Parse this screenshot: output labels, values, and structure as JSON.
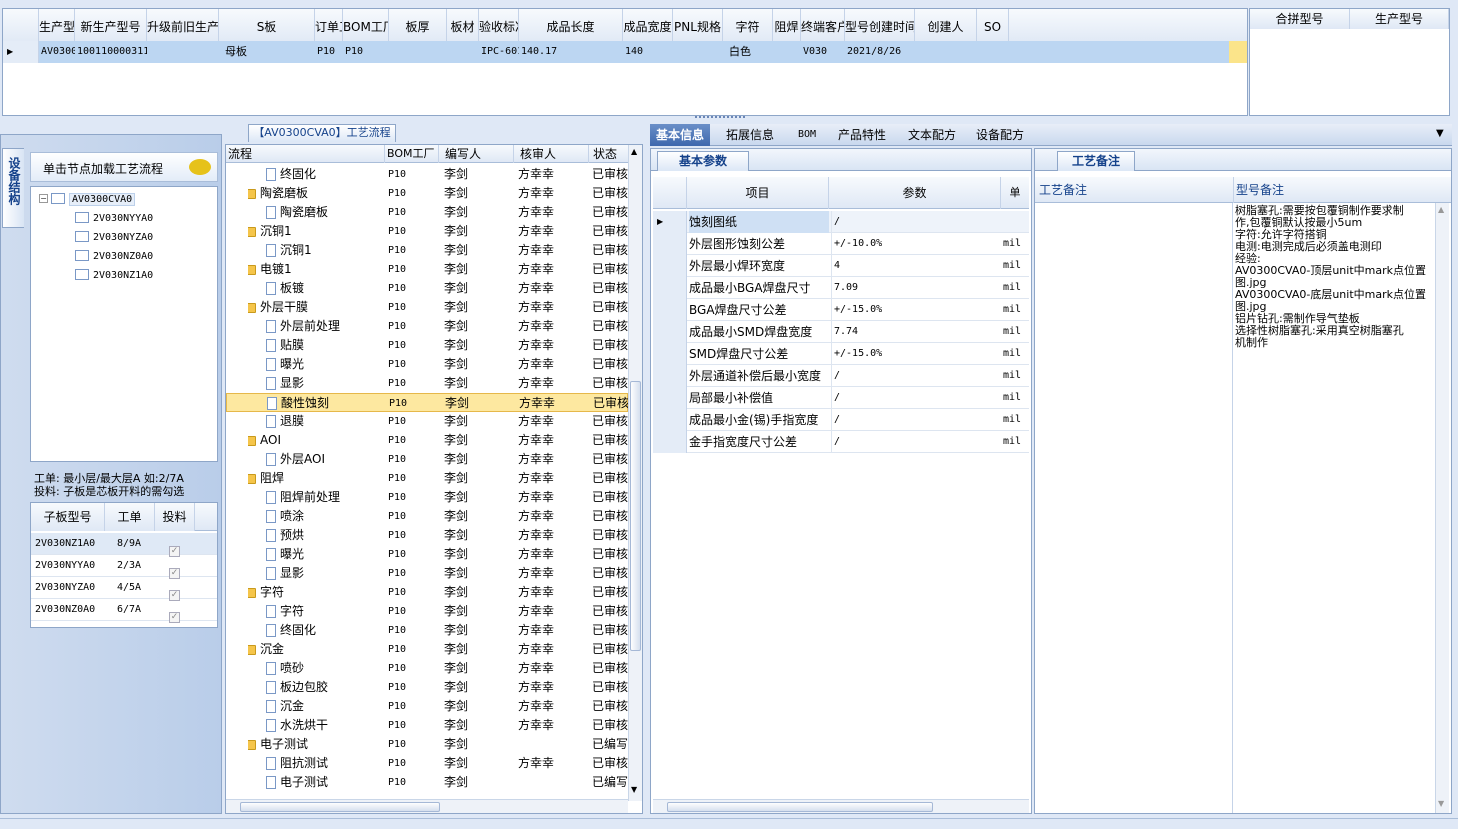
{
  "top_grid": {
    "columns": [
      "生产型号",
      "新生产型号",
      "升级前旧生产型号",
      "S板",
      "订单工厂",
      "BOM工厂",
      "板厚",
      "板材",
      "验收标准",
      "成品长度",
      "成品宽度",
      "PNL规格",
      "字符",
      "阻焊",
      "终端客户代码",
      "型号创建时间",
      "创建人",
      "SO"
    ],
    "row": [
      "AV0300CVA0",
      "10011000031143",
      "",
      "母板",
      "P10",
      "P10",
      "",
      "",
      "IPC-6012 Ⅱ级",
      "140.17",
      "140",
      "",
      "白色",
      "",
      "V030",
      "2021/8/26",
      "",
      ""
    ]
  },
  "right_grid": {
    "columns": [
      "合拼型号",
      "生产型号"
    ]
  },
  "left_panel": {
    "side_tab": "设备结构",
    "hint": "单击节点加载工艺流程",
    "tree_root": "AV0300CVA0",
    "tree_children": [
      "2V030NYYA0",
      "2V030NYZA0",
      "2V030NZ0A0",
      "2V030NZ1A0"
    ],
    "note1": "工单: 最小层/最大层A 如:2/7A",
    "note2": "投料: 子板是芯板开料的需勾选",
    "sub_columns": [
      "子板型号",
      "工单",
      "投料"
    ],
    "sub_rows": [
      {
        "model": "2V030NZ1A0",
        "order": "8/9A"
      },
      {
        "model": "2V030NYYA0",
        "order": "2/3A"
      },
      {
        "model": "2V030NYZA0",
        "order": "4/5A"
      },
      {
        "model": "2V030NZ0A0",
        "order": "6/7A"
      }
    ]
  },
  "process": {
    "title": "【AV0300CVA0】工艺流程",
    "columns": [
      "流程",
      "BOM工厂",
      "编写人",
      "核审人",
      "状态"
    ],
    "rows": [
      {
        "name": "终固化",
        "lvl": 1,
        "bom": "P10",
        "writer": "李剑",
        "reviewer": "方幸幸",
        "status": "已审核"
      },
      {
        "name": "陶瓷磨板",
        "lvl": 0,
        "bom": "P10",
        "writer": "李剑",
        "reviewer": "方幸幸",
        "status": "已审核"
      },
      {
        "name": "陶瓷磨板",
        "lvl": 1,
        "bom": "P10",
        "writer": "李剑",
        "reviewer": "方幸幸",
        "status": "已审核"
      },
      {
        "name": "沉铜1",
        "lvl": 0,
        "bom": "P10",
        "writer": "李剑",
        "reviewer": "方幸幸",
        "status": "已审核"
      },
      {
        "name": "沉铜1",
        "lvl": 1,
        "bom": "P10",
        "writer": "李剑",
        "reviewer": "方幸幸",
        "status": "已审核"
      },
      {
        "name": "电镀1",
        "lvl": 0,
        "bom": "P10",
        "writer": "李剑",
        "reviewer": "方幸幸",
        "status": "已审核"
      },
      {
        "name": "板镀",
        "lvl": 1,
        "bom": "P10",
        "writer": "李剑",
        "reviewer": "方幸幸",
        "status": "已审核"
      },
      {
        "name": "外层干膜",
        "lvl": 0,
        "bom": "P10",
        "writer": "李剑",
        "reviewer": "方幸幸",
        "status": "已审核"
      },
      {
        "name": "外层前处理",
        "lvl": 1,
        "bom": "P10",
        "writer": "李剑",
        "reviewer": "方幸幸",
        "status": "已审核"
      },
      {
        "name": "贴膜",
        "lvl": 1,
        "bom": "P10",
        "writer": "李剑",
        "reviewer": "方幸幸",
        "status": "已审核"
      },
      {
        "name": "曝光",
        "lvl": 1,
        "bom": "P10",
        "writer": "李剑",
        "reviewer": "方幸幸",
        "status": "已审核"
      },
      {
        "name": "显影",
        "lvl": 1,
        "bom": "P10",
        "writer": "李剑",
        "reviewer": "方幸幸",
        "status": "已审核"
      },
      {
        "name": "酸性蚀刻",
        "lvl": 1,
        "bom": "P10",
        "writer": "李剑",
        "reviewer": "方幸幸",
        "status": "已审核",
        "selected": true
      },
      {
        "name": "退膜",
        "lvl": 1,
        "bom": "P10",
        "writer": "李剑",
        "reviewer": "方幸幸",
        "status": "已审核"
      },
      {
        "name": "AOI",
        "lvl": 0,
        "bom": "P10",
        "writer": "李剑",
        "reviewer": "方幸幸",
        "status": "已审核"
      },
      {
        "name": "外层AOI",
        "lvl": 1,
        "bom": "P10",
        "writer": "李剑",
        "reviewer": "方幸幸",
        "status": "已审核"
      },
      {
        "name": "阻焊",
        "lvl": 0,
        "bom": "P10",
        "writer": "李剑",
        "reviewer": "方幸幸",
        "status": "已审核"
      },
      {
        "name": "阻焊前处理",
        "lvl": 1,
        "bom": "P10",
        "writer": "李剑",
        "reviewer": "方幸幸",
        "status": "已审核"
      },
      {
        "name": "喷涂",
        "lvl": 1,
        "bom": "P10",
        "writer": "李剑",
        "reviewer": "方幸幸",
        "status": "已审核"
      },
      {
        "name": "预烘",
        "lvl": 1,
        "bom": "P10",
        "writer": "李剑",
        "reviewer": "方幸幸",
        "status": "已审核"
      },
      {
        "name": "曝光",
        "lvl": 1,
        "bom": "P10",
        "writer": "李剑",
        "reviewer": "方幸幸",
        "status": "已审核"
      },
      {
        "name": "显影",
        "lvl": 1,
        "bom": "P10",
        "writer": "李剑",
        "reviewer": "方幸幸",
        "status": "已审核"
      },
      {
        "name": "字符",
        "lvl": 0,
        "bom": "P10",
        "writer": "李剑",
        "reviewer": "方幸幸",
        "status": "已审核"
      },
      {
        "name": "字符",
        "lvl": 1,
        "bom": "P10",
        "writer": "李剑",
        "reviewer": "方幸幸",
        "status": "已审核"
      },
      {
        "name": "终固化",
        "lvl": 1,
        "bom": "P10",
        "writer": "李剑",
        "reviewer": "方幸幸",
        "status": "已审核"
      },
      {
        "name": "沉金",
        "lvl": 0,
        "bom": "P10",
        "writer": "李剑",
        "reviewer": "方幸幸",
        "status": "已审核"
      },
      {
        "name": "喷砂",
        "lvl": 1,
        "bom": "P10",
        "writer": "李剑",
        "reviewer": "方幸幸",
        "status": "已审核"
      },
      {
        "name": "板边包胶",
        "lvl": 1,
        "bom": "P10",
        "writer": "李剑",
        "reviewer": "方幸幸",
        "status": "已审核"
      },
      {
        "name": "沉金",
        "lvl": 1,
        "bom": "P10",
        "writer": "李剑",
        "reviewer": "方幸幸",
        "status": "已审核"
      },
      {
        "name": "水洗烘干",
        "lvl": 1,
        "bom": "P10",
        "writer": "李剑",
        "reviewer": "方幸幸",
        "status": "已审核"
      },
      {
        "name": "电子测试",
        "lvl": 0,
        "bom": "P10",
        "writer": "李剑",
        "reviewer": "",
        "status": "已编写"
      },
      {
        "name": "阻抗测试",
        "lvl": 1,
        "bom": "P10",
        "writer": "李剑",
        "reviewer": "方幸幸",
        "status": "已审核"
      },
      {
        "name": "电子测试",
        "lvl": 1,
        "bom": "P10",
        "writer": "李剑",
        "reviewer": "",
        "status": "已编写"
      }
    ]
  },
  "tabs": [
    "基本信息",
    "拓展信息",
    "BOM",
    "产品特性",
    "文本配方",
    "设备配方"
  ],
  "basic_params": {
    "panel_title": "基本参数",
    "columns": [
      "项目",
      "参数",
      "单"
    ],
    "rows": [
      {
        "item": "蚀刻图纸",
        "value": "/",
        "unit": ""
      },
      {
        "item": "外层图形蚀刻公差",
        "value": "+/-10.0%",
        "unit": "mil"
      },
      {
        "item": "外层最小焊环宽度",
        "value": "4",
        "unit": "mil"
      },
      {
        "item": "成品最小BGA焊盘尺寸",
        "value": "7.09",
        "unit": "mil"
      },
      {
        "item": "BGA焊盘尺寸公差",
        "value": "+/-15.0%",
        "unit": "mil"
      },
      {
        "item": "成品最小SMD焊盘宽度",
        "value": "7.74",
        "unit": "mil"
      },
      {
        "item": "SMD焊盘尺寸公差",
        "value": "+/-15.0%",
        "unit": "mil"
      },
      {
        "item": "外层通道补偿后最小宽度",
        "value": "/",
        "unit": "mil"
      },
      {
        "item": "局部最小补偿值",
        "value": "/",
        "unit": "mil"
      },
      {
        "item": "成品最小金(锡)手指宽度",
        "value": "/",
        "unit": "mil"
      },
      {
        "item": "金手指宽度尺寸公差",
        "value": "/",
        "unit": "mil"
      }
    ]
  },
  "remarks": {
    "panel_title": "工艺备注",
    "col1": "工艺备注",
    "col2": "型号备注",
    "model_remark_lines": [
      "树脂塞孔:需要按包覆铜制作要求制",
      "作,包覆铜默认按最小5um",
      "字符:允许字符搭铜",
      "电测:电测完成后必须盖电测印",
      "经验:",
      "AV0300CVA0-顶层unit中mark点位置",
      "图.jpg",
      "AV0300CVA0-底层unit中mark点位置",
      "图.jpg",
      "铝片钻孔:需制作导气垫板",
      "选择性树脂塞孔:采用真空树脂塞孔",
      "机制作"
    ]
  }
}
